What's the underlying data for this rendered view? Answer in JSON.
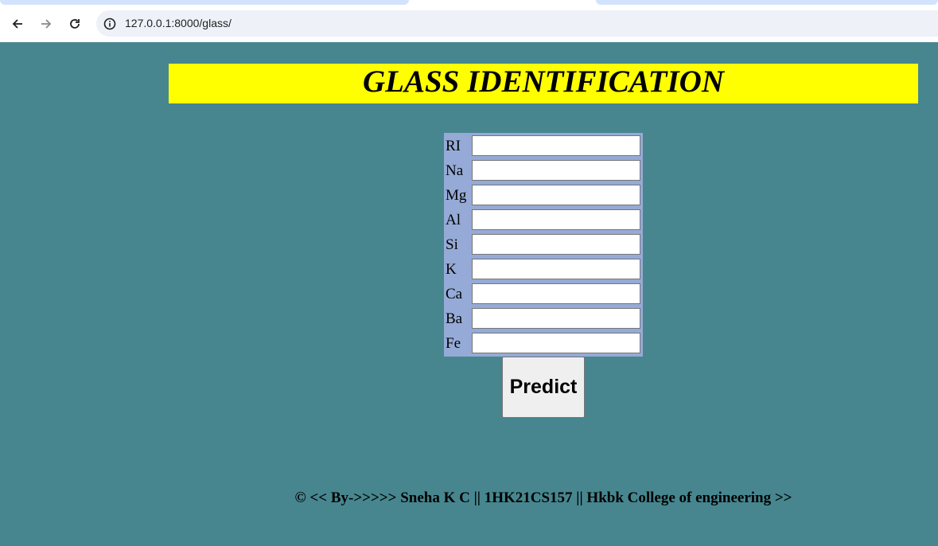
{
  "browser": {
    "url": "127.0.0.1:8000/glass/"
  },
  "page": {
    "title": "GLASS IDENTIFICATION",
    "fields": [
      {
        "label": "RI",
        "value": ""
      },
      {
        "label": "Na",
        "value": ""
      },
      {
        "label": "Mg",
        "value": ""
      },
      {
        "label": "Al",
        "value": ""
      },
      {
        "label": "Si",
        "value": ""
      },
      {
        "label": "K",
        "value": ""
      },
      {
        "label": "Ca",
        "value": ""
      },
      {
        "label": "Ba",
        "value": ""
      },
      {
        "label": "Fe",
        "value": ""
      }
    ],
    "predict_label": "Predict",
    "footer": "© << By->>>>> Sneha K C || 1HK21CS157 || Hkbk College of engineering >>"
  },
  "colors": {
    "page_bg": "#47868f",
    "banner_bg": "#ffff00",
    "form_bg": "#95aad6"
  }
}
